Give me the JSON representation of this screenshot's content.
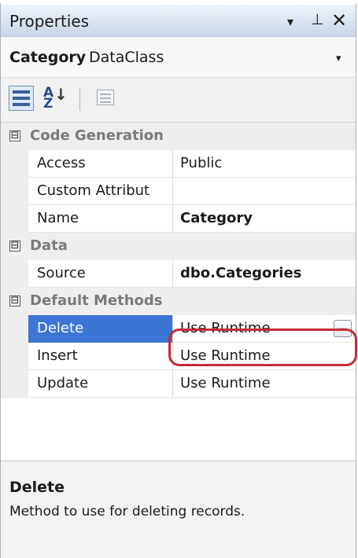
{
  "titlebar": {
    "title": "Properties",
    "dropdown_glyph": "▾",
    "pin_glyph": "⊥",
    "close_glyph": "✕"
  },
  "object_selector": {
    "name": "Category",
    "type": "DataClass",
    "dropdown_glyph": "▾"
  },
  "toolbar": {
    "categorized_icon": "categorized-icon",
    "alphabetical_icon": "alphabetical-icon",
    "property-pages_icon": "property-pages-icon",
    "alpha_top": "A",
    "alpha_bottom": "Z",
    "alpha_arrow": "↓"
  },
  "grid": {
    "expander_glyph": "⊟",
    "categories": [
      {
        "label": "Code Generation",
        "properties": [
          {
            "name": "Access",
            "value": "Public",
            "bold": false
          },
          {
            "name": "Custom Attribut",
            "value": "",
            "bold": false
          },
          {
            "name": "Name",
            "value": "Category",
            "bold": true
          }
        ]
      },
      {
        "label": "Data",
        "properties": [
          {
            "name": "Source",
            "value": "dbo.Categories",
            "bold": true
          }
        ]
      },
      {
        "label": "Default Methods",
        "properties": [
          {
            "name": "Delete",
            "value": "Use Runtime",
            "bold": false,
            "selected": true,
            "ellipsis": "..."
          },
          {
            "name": "Insert",
            "value": "Use Runtime",
            "bold": false
          },
          {
            "name": "Update",
            "value": "Use Runtime",
            "bold": false
          }
        ]
      }
    ]
  },
  "help": {
    "title": "Delete",
    "description": "Method to use for deleting records."
  },
  "colors": {
    "selection": "#3c76d4",
    "highlight_ring": "#c42b38",
    "category_text": "#7a7a7a"
  }
}
